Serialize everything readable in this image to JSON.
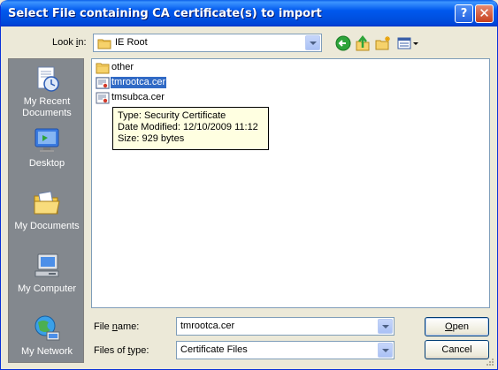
{
  "window": {
    "title": "Select File containing CA certificate(s) to import",
    "help_glyph": "?",
    "close_glyph": "✕"
  },
  "lookin": {
    "label_prefix": "Look ",
    "label_accel": "i",
    "label_suffix": "n:",
    "value": "IE Root",
    "icon": "folder-icon"
  },
  "toolbar": {
    "back_icon": "back-arrow-icon",
    "up_icon": "up-folder-icon",
    "new_folder_icon": "new-folder-icon",
    "views_icon": "views-menu-icon"
  },
  "places": [
    {
      "label_line1": "My Recent",
      "label_line2": "Documents",
      "icon": "recent-documents-icon"
    },
    {
      "label_line1": "Desktop",
      "label_line2": "",
      "icon": "desktop-icon"
    },
    {
      "label_line1": "My Documents",
      "label_line2": "",
      "icon": "my-documents-icon"
    },
    {
      "label_line1": "My Computer",
      "label_line2": "",
      "icon": "my-computer-icon"
    },
    {
      "label_line1": "My Network",
      "label_line2": "",
      "icon": "my-network-icon"
    }
  ],
  "files": [
    {
      "name": "other",
      "type": "folder",
      "selected": false
    },
    {
      "name": "tmrootca.cer",
      "type": "certificate",
      "selected": true
    },
    {
      "name": "tmsubca.cer",
      "type": "certificate",
      "selected": false
    }
  ],
  "tooltip": {
    "type_line": "Type: Security Certificate",
    "date_line": "Date Modified: 12/10/2009 11:12",
    "size_line": "Size: 929 bytes"
  },
  "filename": {
    "label_prefix": "File ",
    "label_accel": "n",
    "label_suffix": "ame:",
    "value": "tmrootca.cer"
  },
  "filetype": {
    "label_prefix": "Files of ",
    "label_accel": "t",
    "label_suffix": "ype:",
    "value": "Certificate Files"
  },
  "buttons": {
    "open_accel": "O",
    "open_rest": "pen",
    "cancel": "Cancel"
  },
  "colors": {
    "titlebar": "#0058ee",
    "selection": "#316ac5",
    "tooltip_bg": "#ffffe1",
    "places_bg": "#83888e"
  }
}
